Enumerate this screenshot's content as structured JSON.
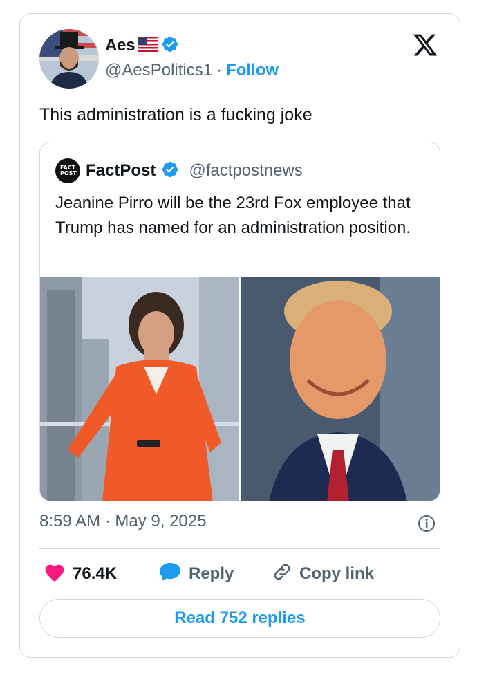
{
  "tweet": {
    "author_name": "Aes",
    "author_flag": "us-flag",
    "author_handle": "@AesPolitics1",
    "separator": "·",
    "follow_label": "Follow",
    "text": "This administration is a fucking joke",
    "timestamp": "8:59 AM · May 9, 2025"
  },
  "quoted": {
    "name": "FactPost",
    "handle": "@factpostnews",
    "logo_text": "FACT POST",
    "text": "Jeanine Pirro will be the 23rd Fox employee that Trump has named for an administration position."
  },
  "actions": {
    "like_count": "76.4K",
    "reply_label": "Reply",
    "copy_label": "Copy link"
  },
  "read_replies_label": "Read 752 replies",
  "colors": {
    "accent": "#1d9bf0",
    "like": "#f91880",
    "verified": "#1d9bf0",
    "text_secondary": "#536471"
  }
}
